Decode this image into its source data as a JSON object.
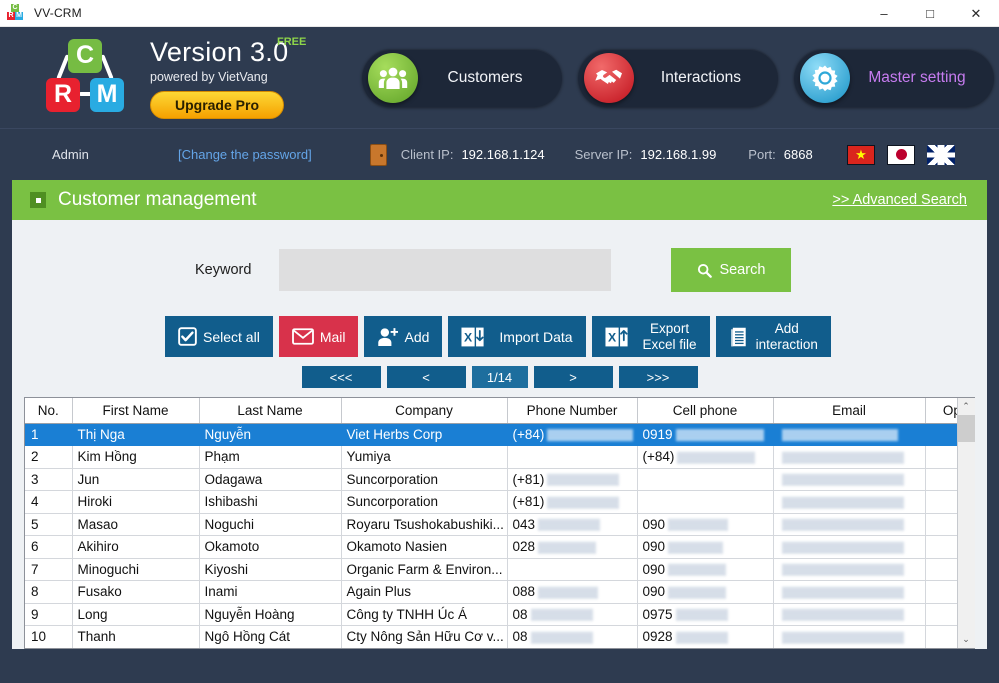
{
  "window": {
    "title": "VV-CRM",
    "minimize": "–",
    "maximize": "□",
    "close": "✕"
  },
  "brand": {
    "logo_letters": {
      "c": "C",
      "r": "R",
      "m": "M"
    },
    "version": "Version 3.0",
    "free_badge": "FREE",
    "powered_by": "powered by VietVang",
    "upgrade_label": "Upgrade Pro"
  },
  "nav": {
    "items": [
      {
        "label": "Customers",
        "icon": "people-icon",
        "color": "#76bc43"
      },
      {
        "label": "Interactions",
        "icon": "handshake-icon",
        "color": "#d8212f"
      },
      {
        "label": "Master setting",
        "icon": "gear-icon",
        "color": "#29abe2"
      }
    ]
  },
  "adminbar": {
    "user": "Admin",
    "change_password": "[Change the password]",
    "client_ip_label": "Client IP:",
    "client_ip_value": "192.168.1.124",
    "server_ip_label": "Server IP:",
    "server_ip_value": "192.168.1.99",
    "port_label": "Port:",
    "port_value": "6868",
    "flags": [
      "vietnam-flag",
      "japan-flag",
      "uk-flag"
    ]
  },
  "page": {
    "title": "Customer management",
    "advanced_search": ">> Advanced Search "
  },
  "search": {
    "keyword_label": "Keyword",
    "keyword_value": "",
    "keyword_placeholder": "",
    "search_button": "Search"
  },
  "actions": [
    {
      "label": "Select all",
      "icon": "checkbox-icon",
      "color": "#115d8c"
    },
    {
      "label": "Mail",
      "icon": "envelope-icon",
      "color": "#d8324b"
    },
    {
      "label": "Add",
      "icon": "user-add-icon",
      "color": "#115d8c"
    },
    {
      "label": "Import Data",
      "icon": "excel-down-icon",
      "color": "#115d8c"
    },
    {
      "label": "Export\nExcel file",
      "line1": "Export",
      "line2": "Excel file",
      "icon": "excel-up-icon",
      "color": "#115d8c"
    },
    {
      "label": "Add\ninteraction",
      "line1": "Add",
      "line2": "interaction",
      "icon": "document-icon",
      "color": "#115d8c"
    }
  ],
  "pager": {
    "first": "<<<",
    "prev": "<",
    "current": "1/14",
    "next": ">",
    "last": ">>>"
  },
  "table": {
    "columns": [
      "No.",
      "First Name",
      "Last Name",
      "Company",
      "Phone Number",
      "Cell phone",
      "Email",
      "Operation"
    ],
    "delete_icon": "trash-icon",
    "rows": [
      {
        "no": "1",
        "first": "Thị Nga",
        "last": "Nguyễn",
        "company": "Viet Herbs Corp",
        "phone": "(+84)",
        "phone_blur": 86,
        "cell": "0919",
        "cell_blur": 88,
        "email": "",
        "email_blur": 116,
        "selected": true
      },
      {
        "no": "2",
        "first": "Kim Hồng",
        "last": "Phạm",
        "company": "Yumiya",
        "phone": "",
        "phone_blur": 0,
        "cell": "(+84)",
        "cell_blur": 78,
        "email": "",
        "email_blur": 122,
        "selected": false
      },
      {
        "no": "3",
        "first": "Jun",
        "last": "Odagawa",
        "company": "Suncorporation",
        "phone": "(+81)",
        "phone_blur": 72,
        "cell": "",
        "cell_blur": 0,
        "email": "",
        "email_blur": 122,
        "selected": false
      },
      {
        "no": "4",
        "first": "Hiroki",
        "last": "Ishibashi",
        "company": "Suncorporation",
        "phone": "(+81)",
        "phone_blur": 72,
        "cell": "",
        "cell_blur": 0,
        "email": "",
        "email_blur": 122,
        "selected": false
      },
      {
        "no": "5",
        "first": "Masao",
        "last": "Noguchi",
        "company": "Royaru Tsushokabushiki...",
        "phone": "043",
        "phone_blur": 62,
        "cell": "090",
        "cell_blur": 60,
        "email": "",
        "email_blur": 122,
        "selected": false
      },
      {
        "no": "6",
        "first": "Akihiro",
        "last": "Okamoto",
        "company": "Okamoto Nasien",
        "phone": "028",
        "phone_blur": 58,
        "cell": "090",
        "cell_blur": 55,
        "email": "",
        "email_blur": 122,
        "selected": false
      },
      {
        "no": "7",
        "first": "Minoguchi",
        "last": "Kiyoshi",
        "company": "Organic Farm & Environ...",
        "phone": "",
        "phone_blur": 0,
        "cell": "090",
        "cell_blur": 58,
        "email": "",
        "email_blur": 122,
        "selected": false
      },
      {
        "no": "8",
        "first": "Fusako",
        "last": "Inami",
        "company": "Again Plus",
        "phone": "088",
        "phone_blur": 60,
        "cell": "090",
        "cell_blur": 58,
        "email": "",
        "email_blur": 122,
        "selected": false
      },
      {
        "no": "9",
        "first": "Long",
        "last": "Nguyễn Hoàng",
        "company": "Công ty TNHH Úc Á",
        "phone": "08",
        "phone_blur": 62,
        "cell": "0975",
        "cell_blur": 52,
        "email": "",
        "email_blur": 122,
        "selected": false
      },
      {
        "no": "10",
        "first": "Thanh",
        "last": "Ngô Hồng Cát",
        "company": "Cty Nông Sản Hữu Cơ v...",
        "phone": "08",
        "phone_blur": 62,
        "cell": "0928",
        "cell_blur": 52,
        "email": "",
        "email_blur": 122,
        "selected": false
      }
    ]
  },
  "scrollbar": {
    "up": "⌃",
    "down": "⌄"
  }
}
